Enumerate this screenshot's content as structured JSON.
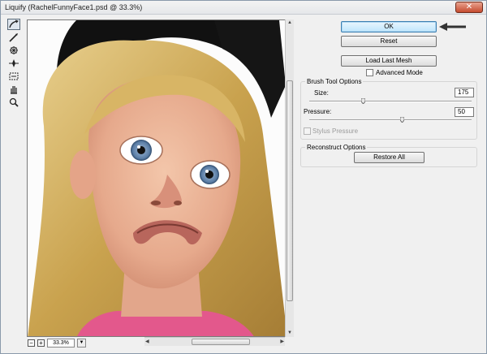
{
  "window": {
    "title": "Liquify (RachelFunnyFace1.psd @ 33.3%)",
    "close_glyph": "✕"
  },
  "tools": [
    "forward-warp-tool",
    "reconstruct-tool",
    "pucker-tool",
    "bloat-tool",
    "shift-pixels-tool",
    "hand-tool",
    "zoom-tool"
  ],
  "buttons": {
    "ok": "OK",
    "reset": "Reset",
    "load_last_mesh": "Load Last Mesh",
    "restore_all": "Restore All"
  },
  "advanced_mode": {
    "label": "Advanced Mode",
    "checked": false
  },
  "brush_tool_options": {
    "title": "Brush Tool Options",
    "size_label": "Size:",
    "size_value": "175",
    "pressure_label": "Pressure:",
    "pressure_value": "50",
    "stylus_pressure_label": "Stylus Pressure"
  },
  "reconstruct_options": {
    "title": "Reconstruct Options"
  },
  "zoom": {
    "value": "33.3%",
    "minus": "−",
    "plus": "+"
  },
  "colors": {
    "accent": "#3c7fb1",
    "arrow": "#333333"
  }
}
